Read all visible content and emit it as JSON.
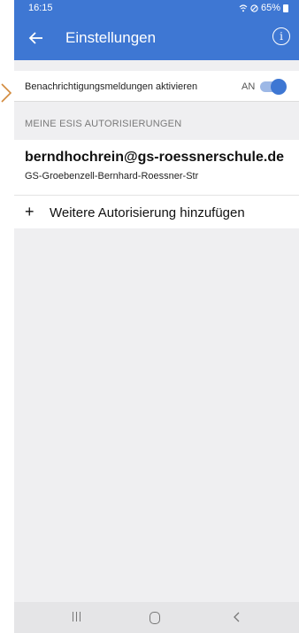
{
  "status_bar": {
    "time": "16:15",
    "battery": "65%"
  },
  "app_bar": {
    "title": "Einstellungen",
    "info_icon": "i"
  },
  "notifications": {
    "label": "Benachrichtigungsmeldungen aktivieren",
    "state": "AN"
  },
  "section": {
    "header": "MEINE ESIS AUTORISIERUNGEN"
  },
  "account": {
    "email": "berndhochrein@gs-roessnerschule.de",
    "school": "GS-Groebenzell-Bernhard-Roessner-Str"
  },
  "add_authorization": {
    "icon": "+",
    "label": "Weitere Autorisierung hinzufügen"
  },
  "icons": {
    "back": "arrow-left-icon",
    "info": "info-icon",
    "recents": "recents-icon",
    "home": "home-icon",
    "nav_back": "chevron-left-icon",
    "pointer": "chevron-right-icon"
  },
  "colors": {
    "accent": "#3e77d3",
    "background": "#efeff1",
    "pointer": "#d38a3c"
  }
}
